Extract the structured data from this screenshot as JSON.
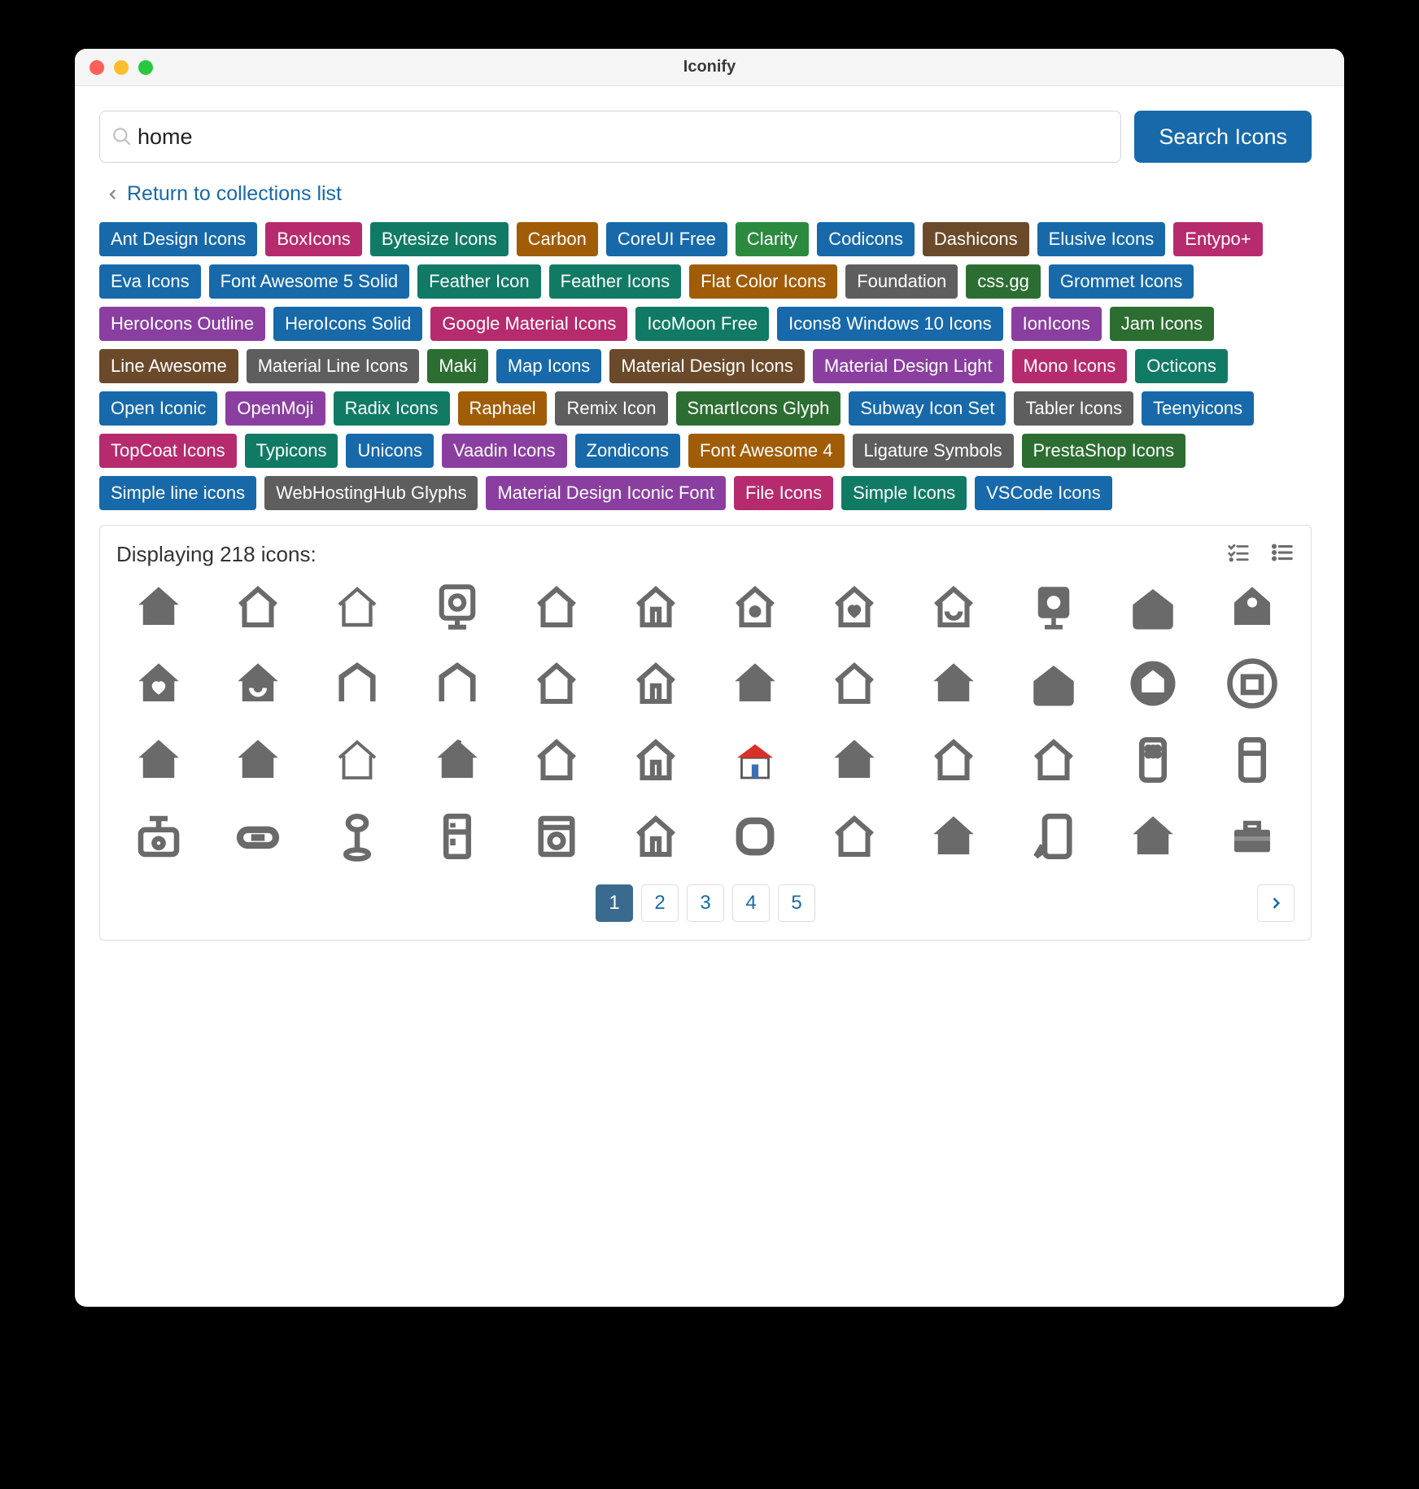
{
  "window": {
    "title": "Iconify"
  },
  "search": {
    "value": "home",
    "placeholder": "",
    "button": "Search Icons"
  },
  "return_link": "Return to collections list",
  "collections": [
    {
      "label": "Ant Design Icons",
      "color": "#1769aa"
    },
    {
      "label": "BoxIcons",
      "color": "#b62b6e"
    },
    {
      "label": "Bytesize Icons",
      "color": "#117a65"
    },
    {
      "label": "Carbon",
      "color": "#a15c07"
    },
    {
      "label": "CoreUI Free",
      "color": "#1769aa"
    },
    {
      "label": "Clarity",
      "color": "#2c8a3f"
    },
    {
      "label": "Codicons",
      "color": "#1769aa"
    },
    {
      "label": "Dashicons",
      "color": "#6b4a2b"
    },
    {
      "label": "Elusive Icons",
      "color": "#1769aa"
    },
    {
      "label": "Entypo+",
      "color": "#b62b6e"
    },
    {
      "label": "Eva Icons",
      "color": "#1769aa"
    },
    {
      "label": "Font Awesome 5 Solid",
      "color": "#1769aa"
    },
    {
      "label": "Feather Icon",
      "color": "#117a65"
    },
    {
      "label": "Feather Icons",
      "color": "#117a65"
    },
    {
      "label": "Flat Color Icons",
      "color": "#a15c07"
    },
    {
      "label": "Foundation",
      "color": "#5e5e5e"
    },
    {
      "label": "css.gg",
      "color": "#2c6e31"
    },
    {
      "label": "Grommet Icons",
      "color": "#1769aa"
    },
    {
      "label": "HeroIcons Outline",
      "color": "#8a3fa0"
    },
    {
      "label": "HeroIcons Solid",
      "color": "#1769aa"
    },
    {
      "label": "Google Material Icons",
      "color": "#b62b6e"
    },
    {
      "label": "IcoMoon Free",
      "color": "#117a65"
    },
    {
      "label": "Icons8 Windows 10 Icons",
      "color": "#1769aa"
    },
    {
      "label": "IonIcons",
      "color": "#8a3fa0"
    },
    {
      "label": "Jam Icons",
      "color": "#2c6e31"
    },
    {
      "label": "Line Awesome",
      "color": "#6b4a2b"
    },
    {
      "label": "Material Line Icons",
      "color": "#5e5e5e"
    },
    {
      "label": "Maki",
      "color": "#2c6e31"
    },
    {
      "label": "Map Icons",
      "color": "#1769aa"
    },
    {
      "label": "Material Design Icons",
      "color": "#6b4a2b"
    },
    {
      "label": "Material Design Light",
      "color": "#8a3fa0"
    },
    {
      "label": "Mono Icons",
      "color": "#b62b6e"
    },
    {
      "label": "Octicons",
      "color": "#117a65"
    },
    {
      "label": "Open Iconic",
      "color": "#1769aa"
    },
    {
      "label": "OpenMoji",
      "color": "#8a3fa0"
    },
    {
      "label": "Radix Icons",
      "color": "#117a65"
    },
    {
      "label": "Raphael",
      "color": "#a15c07"
    },
    {
      "label": "Remix Icon",
      "color": "#5e5e5e"
    },
    {
      "label": "SmartIcons Glyph",
      "color": "#2c6e31"
    },
    {
      "label": "Subway Icon Set",
      "color": "#1769aa"
    },
    {
      "label": "Tabler Icons",
      "color": "#5e5e5e"
    },
    {
      "label": "Teenyicons",
      "color": "#1769aa"
    },
    {
      "label": "TopCoat Icons",
      "color": "#b62b6e"
    },
    {
      "label": "Typicons",
      "color": "#117a65"
    },
    {
      "label": "Unicons",
      "color": "#1769aa"
    },
    {
      "label": "Vaadin Icons",
      "color": "#8a3fa0"
    },
    {
      "label": "Zondicons",
      "color": "#1769aa"
    },
    {
      "label": "Font Awesome 4",
      "color": "#a15c07"
    },
    {
      "label": "Ligature Symbols",
      "color": "#5e5e5e"
    },
    {
      "label": "PrestaShop Icons",
      "color": "#2c6e31"
    },
    {
      "label": "Simple line icons",
      "color": "#1769aa"
    },
    {
      "label": "WebHostingHub Glyphs",
      "color": "#5e5e5e"
    },
    {
      "label": "Material Design Iconic Font",
      "color": "#8a3fa0"
    },
    {
      "label": "File Icons",
      "color": "#b62b6e"
    },
    {
      "label": "Simple Icons",
      "color": "#117a65"
    },
    {
      "label": "VSCode Icons",
      "color": "#1769aa"
    }
  ],
  "results": {
    "count_label": "Displaying 218 icons:",
    "icons": [
      "home-fill",
      "home-outline",
      "home-outline-light",
      "webcam-outline",
      "home-roof-outline",
      "home-roof-door",
      "home-dot-outline",
      "home-heart-outline",
      "home-smile-outline",
      "webcam-fill",
      "home-fill-wide",
      "birdhouse-fill",
      "home-heart-fill",
      "home-smile-fill",
      "home-minimal-outline",
      "home-tall-outline",
      "home-open-outline",
      "home-door-outline",
      "home-fill-simple",
      "home-round-outline",
      "home-fill-gable",
      "home-wide-fill",
      "home-circle-fill",
      "home-circle-outline",
      "home-fill-short",
      "home-fill-dark",
      "home-line-thin",
      "home-fill-slash",
      "home-arch-outline",
      "home-arch-door",
      "home-color",
      "home-solid",
      "home-frame",
      "home-frame-round",
      "smartphone-home",
      "home-appliance",
      "radio-home",
      "link-home",
      "lamp-home",
      "fridge-home",
      "washer-home",
      "home-tall-door",
      "home-square-round",
      "home-v-outline",
      "home-fill-v",
      "home-screen",
      "home-fill-v2",
      "toolbox-home"
    ]
  },
  "pagination": {
    "pages": [
      "1",
      "2",
      "3",
      "4",
      "5"
    ],
    "active": "1",
    "next": "›"
  }
}
